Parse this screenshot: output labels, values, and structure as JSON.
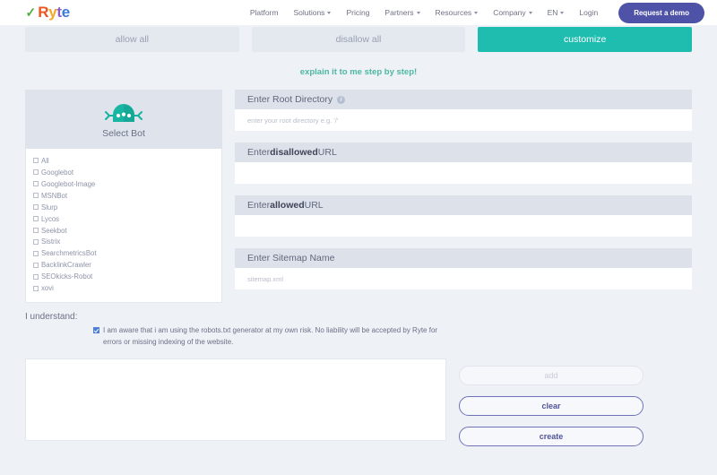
{
  "header": {
    "logo": {
      "check": "✓",
      "r": "R",
      "y": "y",
      "t": "t",
      "e": "e"
    },
    "nav": [
      {
        "label": "Platform",
        "caret": false
      },
      {
        "label": "Solutions",
        "caret": true
      },
      {
        "label": "Pricing",
        "caret": false
      },
      {
        "label": "Partners",
        "caret": true
      },
      {
        "label": "Resources",
        "caret": true
      },
      {
        "label": "Company",
        "caret": true
      },
      {
        "label": "EN",
        "caret": true
      },
      {
        "label": "Login",
        "caret": false
      }
    ],
    "demo_button": "Request a demo"
  },
  "modes": [
    {
      "label": "allow all",
      "active": false
    },
    {
      "label": "disallow all",
      "active": false
    },
    {
      "label": "customize",
      "active": true
    }
  ],
  "explain_link": "explain it to me step by step!",
  "bot_panel": {
    "title": "Select Bot",
    "icon": "robot-icon",
    "items": [
      "All",
      "Googlebot",
      "Googlebot-Image",
      "MSNBot",
      "Slurp",
      "Lycos",
      "Seekbot",
      "Sistrix",
      "SearchmetricsBot",
      "BacklinkCrawler",
      "SEOkicks-Robot",
      "xovi"
    ]
  },
  "fields": [
    {
      "prefix": "Enter Root Directory",
      "bold": "",
      "suffix": "",
      "info": true,
      "placeholder": "enter your root directory e.g. '/'",
      "value": ""
    },
    {
      "prefix": "Enter ",
      "bold": "disallowed",
      "suffix": " URL",
      "info": false,
      "placeholder": "",
      "value": ""
    },
    {
      "prefix": "Enter ",
      "bold": "allowed",
      "suffix": " URL",
      "info": false,
      "placeholder": "",
      "value": ""
    },
    {
      "prefix": "Enter Sitemap Name",
      "bold": "",
      "suffix": "",
      "info": false,
      "placeholder": "sitemap.xml",
      "value": ""
    }
  ],
  "understand": {
    "label": "I understand:",
    "checked": true,
    "text": "I am aware that i am using the robots.txt generator at my own risk. No liability will be accepted by Ryte for errors or missing indexing of the website."
  },
  "output": {
    "value": ""
  },
  "actions": [
    {
      "label": "add",
      "state": "disabled"
    },
    {
      "label": "clear",
      "state": "outline"
    },
    {
      "label": "create",
      "state": "outline"
    }
  ],
  "colors": {
    "accent_teal": "#1fbdb0",
    "brand_purple": "#4e53a8",
    "page_bg": "#eef1f6",
    "panel_header": "#dde1ea",
    "checkbox_blue": "#4e7ed8"
  }
}
